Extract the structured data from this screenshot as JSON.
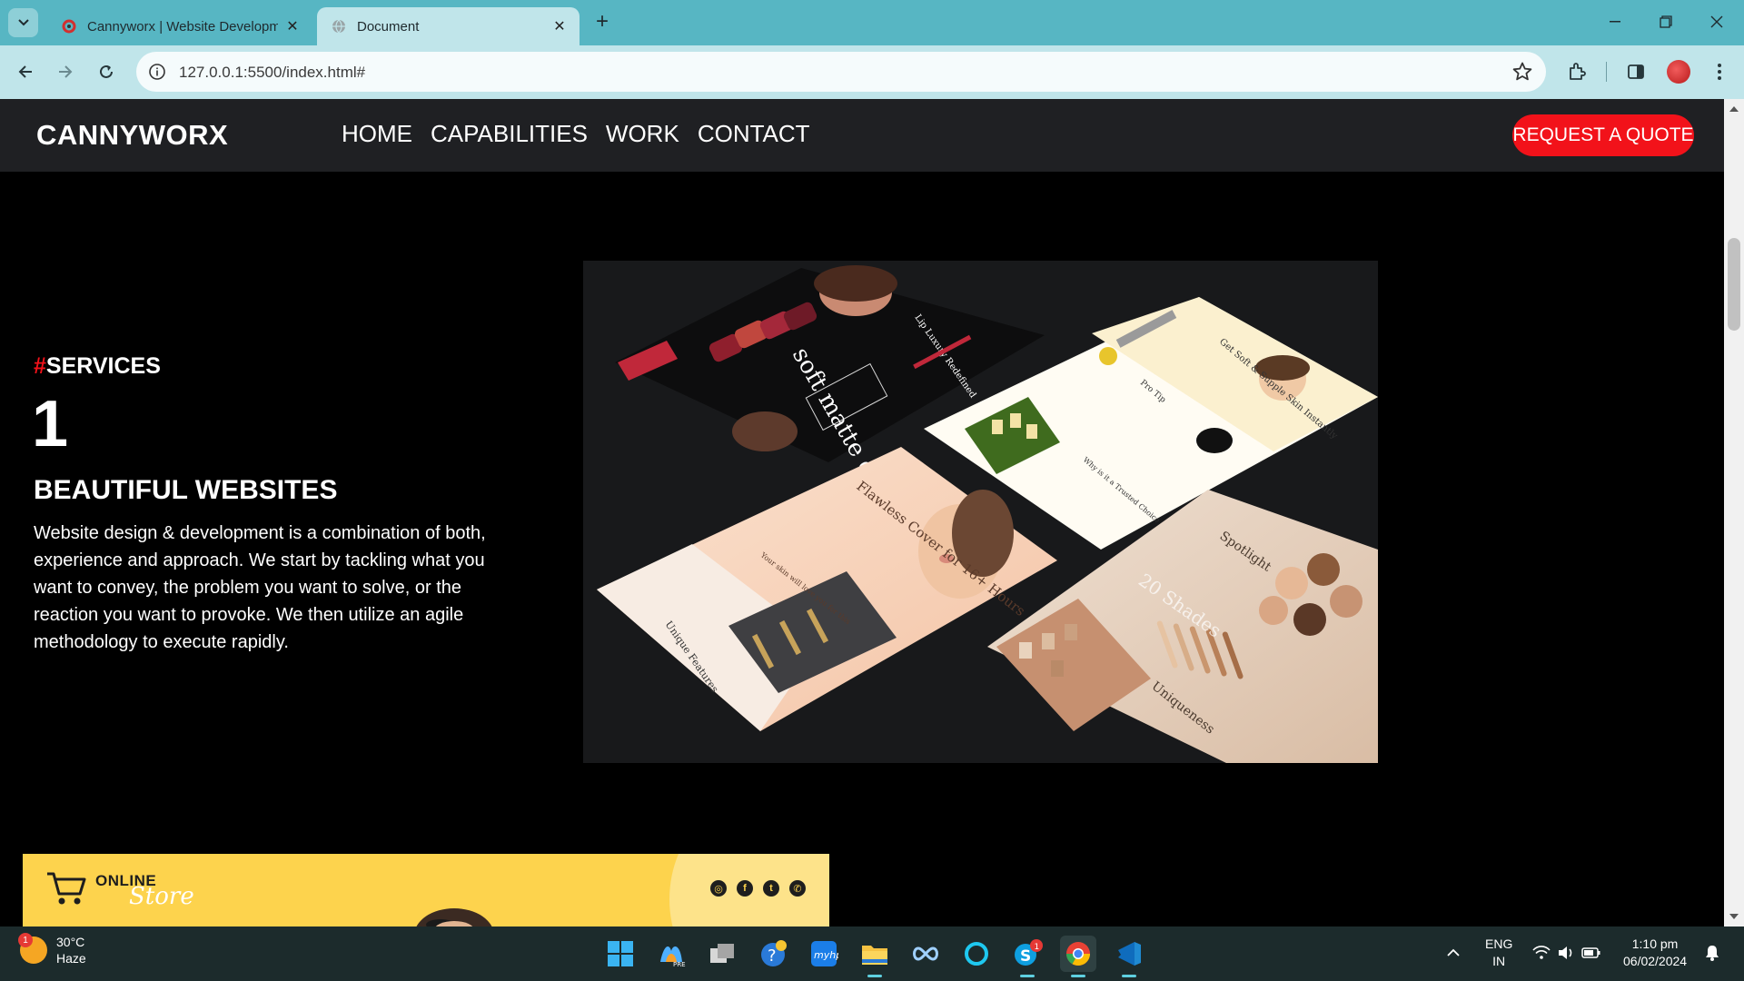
{
  "browser": {
    "tabs": [
      {
        "title": "Cannyworx | Website Developm",
        "active": false
      },
      {
        "title": "Document",
        "active": true
      }
    ],
    "url": "127.0.0.1:5500/index.html#"
  },
  "site": {
    "brand": "CANNYWORX",
    "nav": [
      "HOME",
      "CAPABILITIES",
      "WORK",
      "CONTACT"
    ],
    "cta": "REQUEST A QUOTE"
  },
  "service": {
    "tag_hash": "#",
    "tag": "SERVICES",
    "number": "1",
    "title": "BEAUTIFUL WEBSITES",
    "description": "Website design & development is a combination of both, experience and approach. We start by tackling what you want to convey, the problem you want to solve, or the reaction you want to provoke. We then utilize an agile methodology to execute rapidly."
  },
  "mockup": {
    "texts": [
      "soft matte cream",
      "Lip Luxury Redefined",
      "Get Soft & Supple Skin Instantly",
      "Pro Tip",
      "Why is it a Trusted Choice of Experts?",
      "Flawless Cover for 16+ Hours",
      "Your skin will love you for this",
      "Unique Features",
      "Spotlight",
      "20 Shades",
      "Uniqueness"
    ]
  },
  "store": {
    "line1": "ONLINE",
    "line2": "Store",
    "social": [
      "instagram-icon",
      "facebook-icon",
      "twitter-icon",
      "whatsapp-icon"
    ]
  },
  "taskbar": {
    "weather_temp": "30°C",
    "weather_desc": "Haze",
    "weather_badge": "1",
    "skype_badge": "1",
    "lang1": "ENG",
    "lang2": "IN",
    "time": "1:10 pm",
    "date": "06/02/2024"
  },
  "colors": {
    "accent_red": "#f2121a",
    "header_bg": "#1f2023",
    "chrome_tabbar": "#57b6c3",
    "chrome_toolbar": "#c0e5ea",
    "store_yellow": "#fdd34d"
  }
}
